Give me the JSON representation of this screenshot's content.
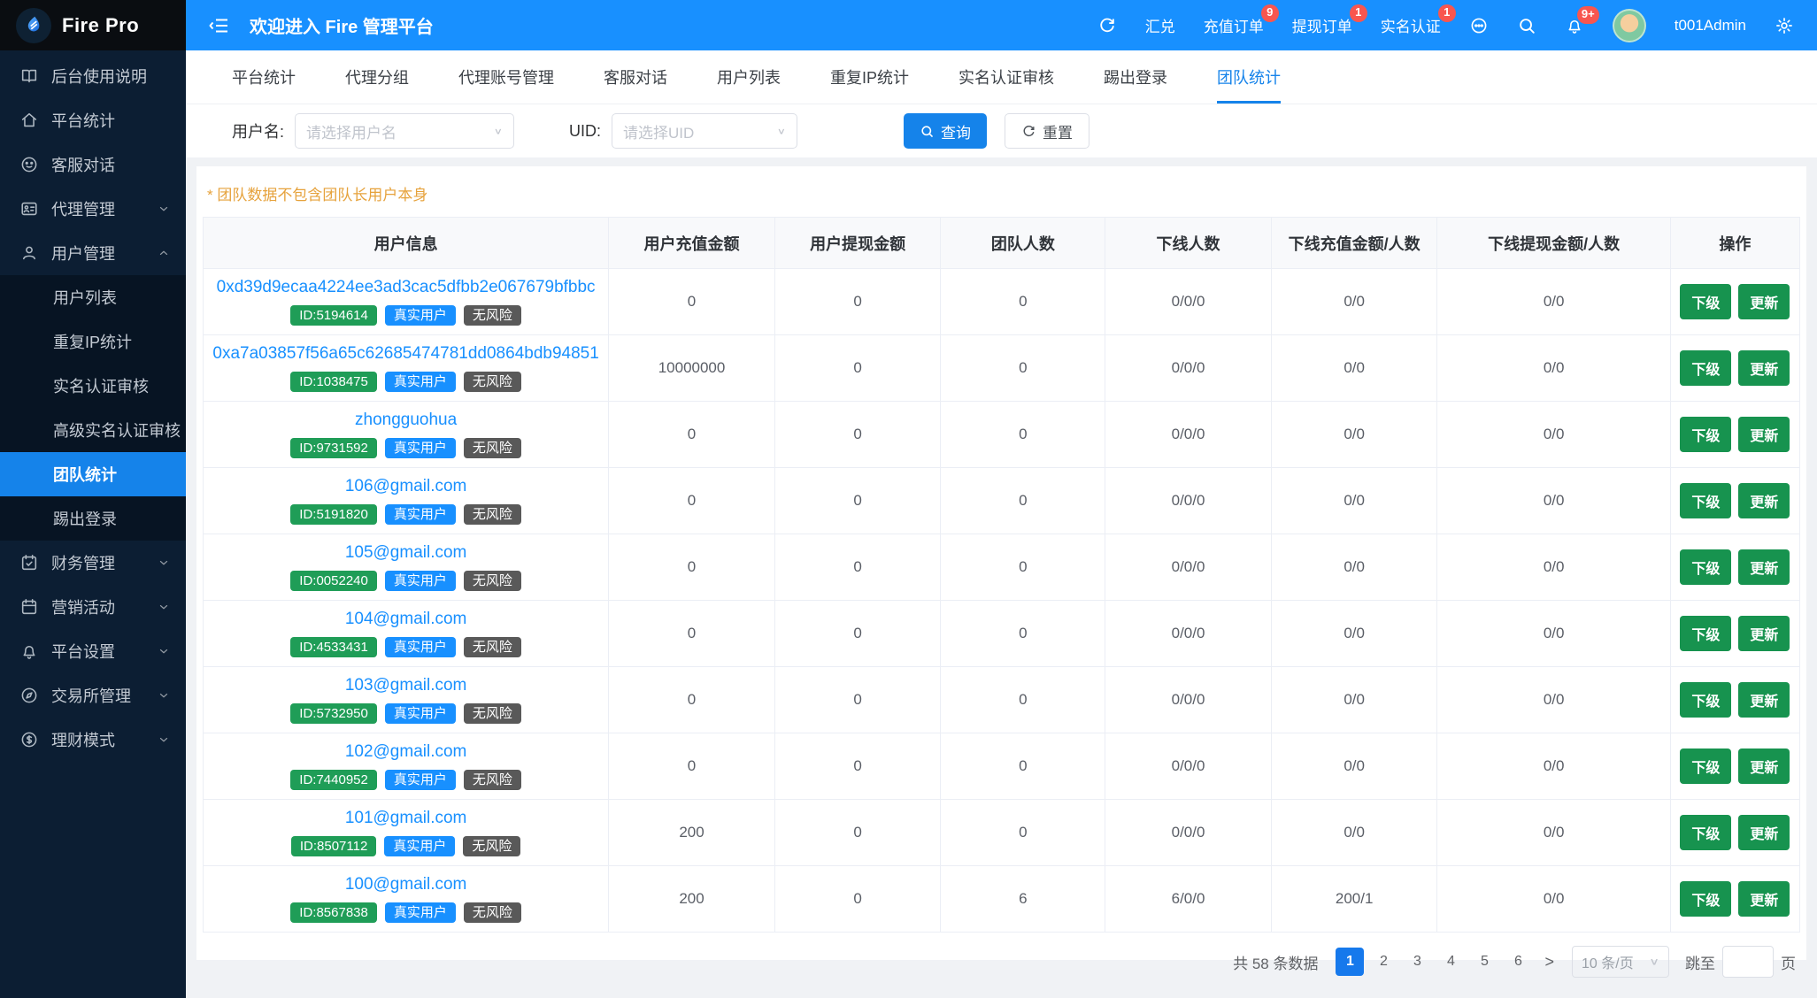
{
  "brand": {
    "name": "Fire Pro",
    "logo_icon": "flame-icon"
  },
  "header": {
    "welcome": "欢迎进入 Fire 管理平台",
    "right": [
      {
        "type": "icon",
        "icon": "refresh",
        "name": "refresh-icon"
      },
      {
        "type": "text",
        "label": "汇兑"
      },
      {
        "type": "text",
        "label": "充值订单",
        "badge": "9"
      },
      {
        "type": "text",
        "label": "提现订单",
        "badge": "1"
      },
      {
        "type": "text",
        "label": "实名认证",
        "badge": "1"
      },
      {
        "type": "icon",
        "icon": "chat",
        "name": "chat-icon"
      },
      {
        "type": "icon",
        "icon": "search",
        "name": "search-icon"
      },
      {
        "type": "icon",
        "icon": "bell",
        "name": "bell-icon",
        "badge": "9+"
      },
      {
        "type": "avatar",
        "name": "avatar"
      },
      {
        "type": "text",
        "label": "t001Admin",
        "name": "username-label"
      },
      {
        "type": "icon",
        "icon": "gear",
        "name": "gear-icon"
      }
    ]
  },
  "sidebar": {
    "items": [
      {
        "icon": "book",
        "label": "后台使用说明"
      },
      {
        "icon": "home",
        "label": "平台统计"
      },
      {
        "icon": "smiley",
        "label": "客服对话"
      },
      {
        "icon": "idcard",
        "label": "代理管理",
        "chevron": "down"
      },
      {
        "icon": "user",
        "label": "用户管理",
        "chevron": "up",
        "children": [
          {
            "label": "用户列表"
          },
          {
            "label": "重复IP统计"
          },
          {
            "label": "实名认证审核"
          },
          {
            "label": "高级实名认证审核"
          },
          {
            "label": "团队统计",
            "active": true
          },
          {
            "label": "踢出登录"
          }
        ]
      },
      {
        "icon": "calcheck",
        "label": "财务管理",
        "chevron": "down"
      },
      {
        "icon": "calendar",
        "label": "营销活动",
        "chevron": "down"
      },
      {
        "icon": "bell",
        "label": "平台设置",
        "chevron": "down"
      },
      {
        "icon": "compass",
        "label": "交易所管理",
        "chevron": "down"
      },
      {
        "icon": "dollar",
        "label": "理财模式",
        "chevron": "down"
      }
    ]
  },
  "tabs": {
    "items": [
      "平台统计",
      "代理分组",
      "代理账号管理",
      "客服对话",
      "用户列表",
      "重复IP统计",
      "实名认证审核",
      "踢出登录",
      "团队统计"
    ],
    "active_index": 8
  },
  "filters": {
    "username_label": "用户名:",
    "username_placeholder": "请选择用户名",
    "uid_label": "UID:",
    "uid_placeholder": "请选择UID",
    "search_label": "查询",
    "reset_label": "重置"
  },
  "notice": "* 团队数据不包含团队长用户本身",
  "table": {
    "columns": [
      "用户信息",
      "用户充值金额",
      "用户提现金额",
      "团队人数",
      "下线人数",
      "下线充值金额/人数",
      "下线提现金额/人数",
      "操作"
    ],
    "col_widths": [
      "25.4%",
      "10.4%",
      "10.4%",
      "10.3%",
      "10.4%",
      "10.4%",
      "14.6%",
      "8.1%"
    ],
    "row_tags": [
      "真实用户",
      "无风险"
    ],
    "action_labels": [
      "下级",
      "更新"
    ],
    "rows": [
      {
        "name": "0xd39d9ecaa4224ee3ad3cac5dfbb2e067679bfbbc",
        "id_label": "ID:5194614",
        "values": [
          "0",
          "0",
          "0",
          "0/0/0",
          "0/0",
          "0/0"
        ]
      },
      {
        "name": "0xa7a03857f56a65c62685474781dd0864bdb94851",
        "id_label": "ID:1038475",
        "values": [
          "10000000",
          "0",
          "0",
          "0/0/0",
          "0/0",
          "0/0"
        ]
      },
      {
        "name": "zhongguohua",
        "id_label": "ID:9731592",
        "values": [
          "0",
          "0",
          "0",
          "0/0/0",
          "0/0",
          "0/0"
        ]
      },
      {
        "name": "106@gmail.com",
        "id_label": "ID:5191820",
        "values": [
          "0",
          "0",
          "0",
          "0/0/0",
          "0/0",
          "0/0"
        ]
      },
      {
        "name": "105@gmail.com",
        "id_label": "ID:0052240",
        "values": [
          "0",
          "0",
          "0",
          "0/0/0",
          "0/0",
          "0/0"
        ]
      },
      {
        "name": "104@gmail.com",
        "id_label": "ID:4533431",
        "values": [
          "0",
          "0",
          "0",
          "0/0/0",
          "0/0",
          "0/0"
        ]
      },
      {
        "name": "103@gmail.com",
        "id_label": "ID:5732950",
        "values": [
          "0",
          "0",
          "0",
          "0/0/0",
          "0/0",
          "0/0"
        ]
      },
      {
        "name": "102@gmail.com",
        "id_label": "ID:7440952",
        "values": [
          "0",
          "0",
          "0",
          "0/0/0",
          "0/0",
          "0/0"
        ]
      },
      {
        "name": "101@gmail.com",
        "id_label": "ID:8507112",
        "values": [
          "200",
          "0",
          "0",
          "0/0/0",
          "0/0",
          "0/0"
        ]
      },
      {
        "name": "100@gmail.com",
        "id_label": "ID:8567838",
        "values": [
          "200",
          "0",
          "6",
          "6/0/0",
          "200/1",
          "0/0"
        ]
      }
    ]
  },
  "pagination": {
    "total_text": "共 58 条数据",
    "pages": [
      "1",
      "2",
      "3",
      "4",
      "5",
      "6"
    ],
    "active_page": "1",
    "next_symbol": ">",
    "page_size": "10 条/页",
    "jump_prefix": "跳至",
    "jump_suffix": "页"
  }
}
